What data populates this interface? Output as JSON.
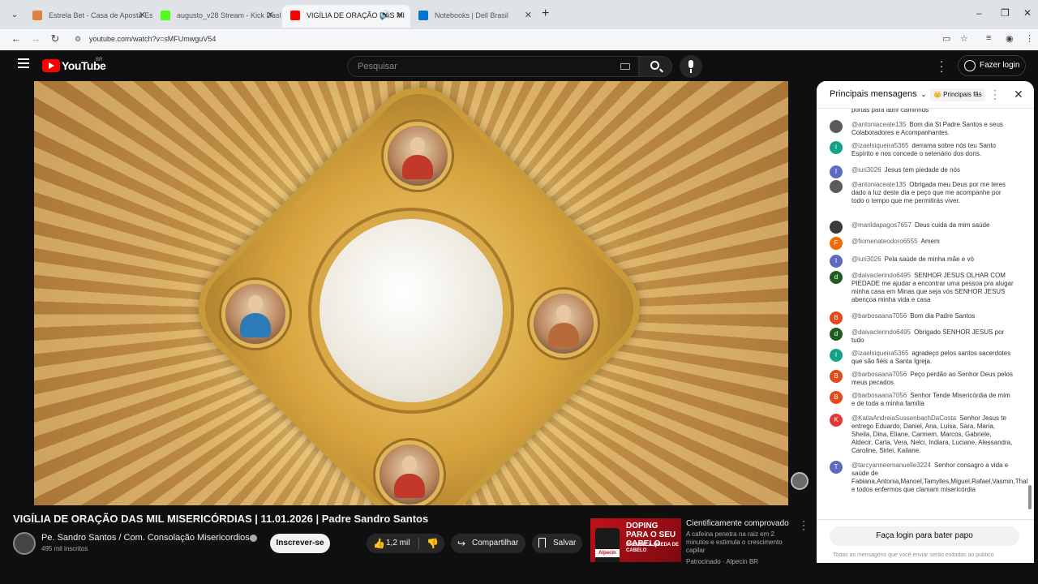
{
  "browser": {
    "tabs": [
      {
        "title": "Estrela Bet - Casa de Aposta Esp",
        "favicon_color": "#e0803a"
      },
      {
        "title": "augusto_v28 Stream - Kick Dash",
        "favicon_color": "#53fc18"
      },
      {
        "title": "VIGÍLIA DE ORAÇÃO DAS MI",
        "favicon_color": "#ff0000"
      },
      {
        "title": "Notebooks | Dell Brasil",
        "favicon_color": "#0076ce"
      }
    ],
    "new_tab": "+",
    "url": "youtube.com/watch?v=sMFUmwguV54",
    "window_controls": {
      "minimize": "–",
      "maximize": "❐",
      "close": "✕"
    }
  },
  "yt": {
    "wordmark": "YouTube",
    "country": "BR",
    "search_placeholder": "Pesquisar",
    "login_label": "Fazer login"
  },
  "video": {
    "title": "VIGÍLIA DE ORAÇÃO DAS MIL MISERICÓRDIAS | 11.01.2026 | Padre Sandro Santos",
    "channel": "Pe. Sandro Santos / Com. Consolação Misericordiosa",
    "subscribers": "495 mil inscritos",
    "subscribe_label": "Inscrever-se",
    "likes": "1,2 mil",
    "share_label": "Compartilhar",
    "save_label": "Salvar"
  },
  "ad": {
    "headline": "DOPING PARA O SEU CABELO",
    "subline": "PREVINE A QUEDA DE CABELO",
    "brand": "Alpecin",
    "title": "Cientificamente comprovado",
    "description": "A cafeína penetra na raiz em 2 minutos e estimula o crescimento capilar",
    "sponsor": "Patrocinado · Alpecin BR"
  },
  "chat": {
    "mode": "Principais mensagens",
    "chip": "👑 Principais fãs",
    "login_label": "Faça login para bater papo",
    "note": "Todas as mensagens que você enviar serão exibidas ao público",
    "messages": [
      {
        "initial": "",
        "color": "#555555",
        "author": "",
        "text": "portas para abrir caminhos"
      },
      {
        "initial": "",
        "color": "#5b5b5b",
        "author": "@antoniaceate135",
        "text": "Bom dia St Padre Santos e seus Colaboradores e Acompanhantes."
      },
      {
        "initial": "I",
        "color": "#12a38a",
        "author": "@izaelsiqueira5365",
        "text": "derrama sobre nós teu Santo Espírito e nos concede o setenário dos dons."
      },
      {
        "initial": "I",
        "color": "#5c6bc0",
        "author": "@iuri3026",
        "text": "Jesus tem piedade de nós"
      },
      {
        "initial": "",
        "color": "#5b5b5b",
        "author": "@antoniaceate135",
        "text": "Obrigada meu Deus por me teres dado a luz deste dia e peço que me acompanhe por todo o tempo que me permitirás viver."
      },
      {
        "initial": "",
        "color": "#3a3a3a",
        "author": "@marildapagos7657",
        "text": "Deus cuida da mim saúde"
      },
      {
        "initial": "F",
        "color": "#ef6c00",
        "author": "@fiomenateodoro6555",
        "text": "Amem"
      },
      {
        "initial": "I",
        "color": "#5c6bc0",
        "author": "@iuri3026",
        "text": "Pela saúde de minha mãe e vó"
      },
      {
        "initial": "d",
        "color": "#1b5e20",
        "author": "@daivaclerindo6495",
        "text": "SENHOR JESUS OLHAR COM PIEDADE me ajudar a encontrar uma pessoa pra alugar minha casa em Minas que seja vós SENHOR JESUS abençoa minha vida e casa"
      },
      {
        "initial": "B",
        "color": "#e64a19",
        "author": "@barbosaana7056",
        "text": "Bom dia Padre Santos"
      },
      {
        "initial": "d",
        "color": "#1b5e20",
        "author": "@daivaclerindo6495",
        "text": "Obrigado SENHOR JESUS por tudo"
      },
      {
        "initial": "I",
        "color": "#12a38a",
        "author": "@izaelsiqueira5365",
        "text": "agradeço pelos santos sacerdotes que são fiéis a Santa Igreja."
      },
      {
        "initial": "B",
        "color": "#e64a19",
        "author": "@barbosaana7056",
        "text": "Peço perdão ao Senhor Deus pelos meus pecados"
      },
      {
        "initial": "B",
        "color": "#e64a19",
        "author": "@barbosaana7056",
        "text": "Senhor Tende Misericórdia de mim e de toda a minha família"
      },
      {
        "initial": "K",
        "color": "#e53935",
        "author": "@KatiaAndreiaSussenbachDaCosta",
        "text": "Senhor Jesus te entrego Eduardo, Daniel, Ana, Luísa, Sara, Maria, Sheila, Dina, Eliane, Carmem, Marcos, Gabriele, Aldecir, Carla, Vera, Nelci, Indiara, Luciane, Alessandra, Caroline, Sirlei, Kailane."
      },
      {
        "initial": "T",
        "color": "#5c6bc0",
        "author": "@tarcyanneemanuelle3224",
        "text": "Senhor consagro a vida e saúde de Fabiana,Antonia,Manoel,Tamylles,Miguel,Rafael,Vasmin,Thalyta,Henberto,Tarcyto,Hélia,Socorro,Antônio,Maurício,Isadora,Flávio e todos enfermos que clamam misericórdia"
      }
    ]
  }
}
